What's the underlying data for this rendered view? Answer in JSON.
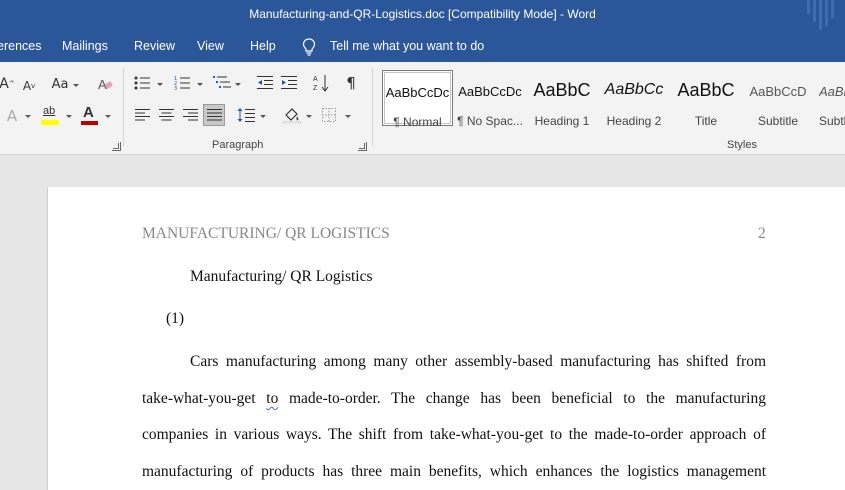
{
  "window": {
    "title": "Manufacturing-and-QR-Logistics.doc [Compatibility Mode]  -  Word",
    "accent": "#2b579a"
  },
  "tabs": [
    "erences",
    "Mailings",
    "Review",
    "View",
    "Help"
  ],
  "tell_me": "Tell me what you want to do",
  "ribbon": {
    "font": {
      "grow_font": "A",
      "shrink_font": "A",
      "change_case": "Aa",
      "text_effects": "A",
      "highlight": "ab",
      "font_color": "A",
      "highlight_color": "#ffff00",
      "font_color_value": "#c00000"
    },
    "paragraph_label": "Paragraph",
    "styles_label": "Styles",
    "styles": [
      {
        "preview": "AaBbCcDc",
        "name": "¶ Normal",
        "selected": true
      },
      {
        "preview": "AaBbCcDc",
        "name": "¶ No Spac...",
        "selected": false
      },
      {
        "preview": "AaBbC",
        "name": "Heading 1",
        "selected": false
      },
      {
        "preview": "AaBbCc",
        "name": "Heading 2",
        "selected": false
      },
      {
        "preview": "AaBbC",
        "name": "Title",
        "selected": false
      },
      {
        "preview": "AaBbCcD",
        "name": "Subtitle",
        "selected": false
      },
      {
        "preview": "AaBb",
        "name": "Subtl",
        "selected": false
      }
    ]
  },
  "document": {
    "running_head": "MANUFACTURING/ QR LOGISTICS",
    "page_number": "2",
    "title": "Manufacturing/ QR Logistics",
    "section": "(1)",
    "lines": [
      "Cars manufacturing among many other assembly-based manufacturing has shifted from",
      "take-what-you-get to made-to-order. The change has been beneficial to the manufacturing",
      "companies in various ways. The shift from take-what-you-get to the made-to-order approach of",
      "manufacturing of products has three main benefits, which enhances the logistics management"
    ],
    "line2_parts": {
      "before": "take-what-you-get ",
      "flagged": "to",
      "after": " made-to-order. The change has been beneficial to the manufacturing"
    }
  }
}
